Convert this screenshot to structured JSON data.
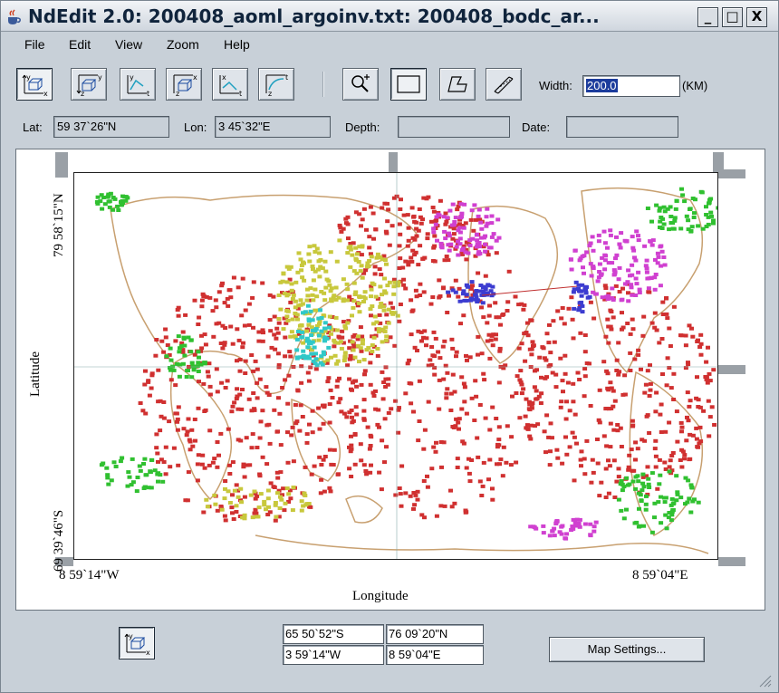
{
  "window": {
    "title": "NdEdit 2.0: 200408_aoml_argoinv.txt: 200408_bodc_ar...",
    "minimize_label": "_",
    "maximize_label": "□",
    "close_label": "X"
  },
  "menu": {
    "items": [
      "File",
      "Edit",
      "View",
      "Zoom",
      "Help"
    ]
  },
  "toolbar": {
    "width_label": "Width:",
    "width_value": "200.0",
    "width_unit": "(KM)"
  },
  "readouts": {
    "lat_label": "Lat:",
    "lat_value": "59 37`26\"N",
    "lon_label": "Lon:",
    "lon_value": "3  45`32\"E",
    "depth_label": "Depth:",
    "depth_value": "",
    "date_label": "Date:",
    "date_value": ""
  },
  "map": {
    "y_axis_label": "Latitude",
    "x_axis_label": "Longitude",
    "lat_top_tick": "79  58`15\"N",
    "lat_bottom_tick": "69  39`46\"S",
    "lon_left_tick": "8   59`14\"W",
    "lon_right_tick": "8   59`04\"E",
    "land_color": "#c8a070",
    "series_colors": [
      "#d03030",
      "#c8c83c",
      "#d040d0",
      "#30c030",
      "#3c3cd0",
      "#30c8c8"
    ]
  },
  "bounds": {
    "south": "65  50`52\"S",
    "north": "76  09`20\"N",
    "west": "3   59`14\"W",
    "east": "8   59`04\"E"
  },
  "bottom": {
    "map_settings_label": "Map Settings..."
  }
}
